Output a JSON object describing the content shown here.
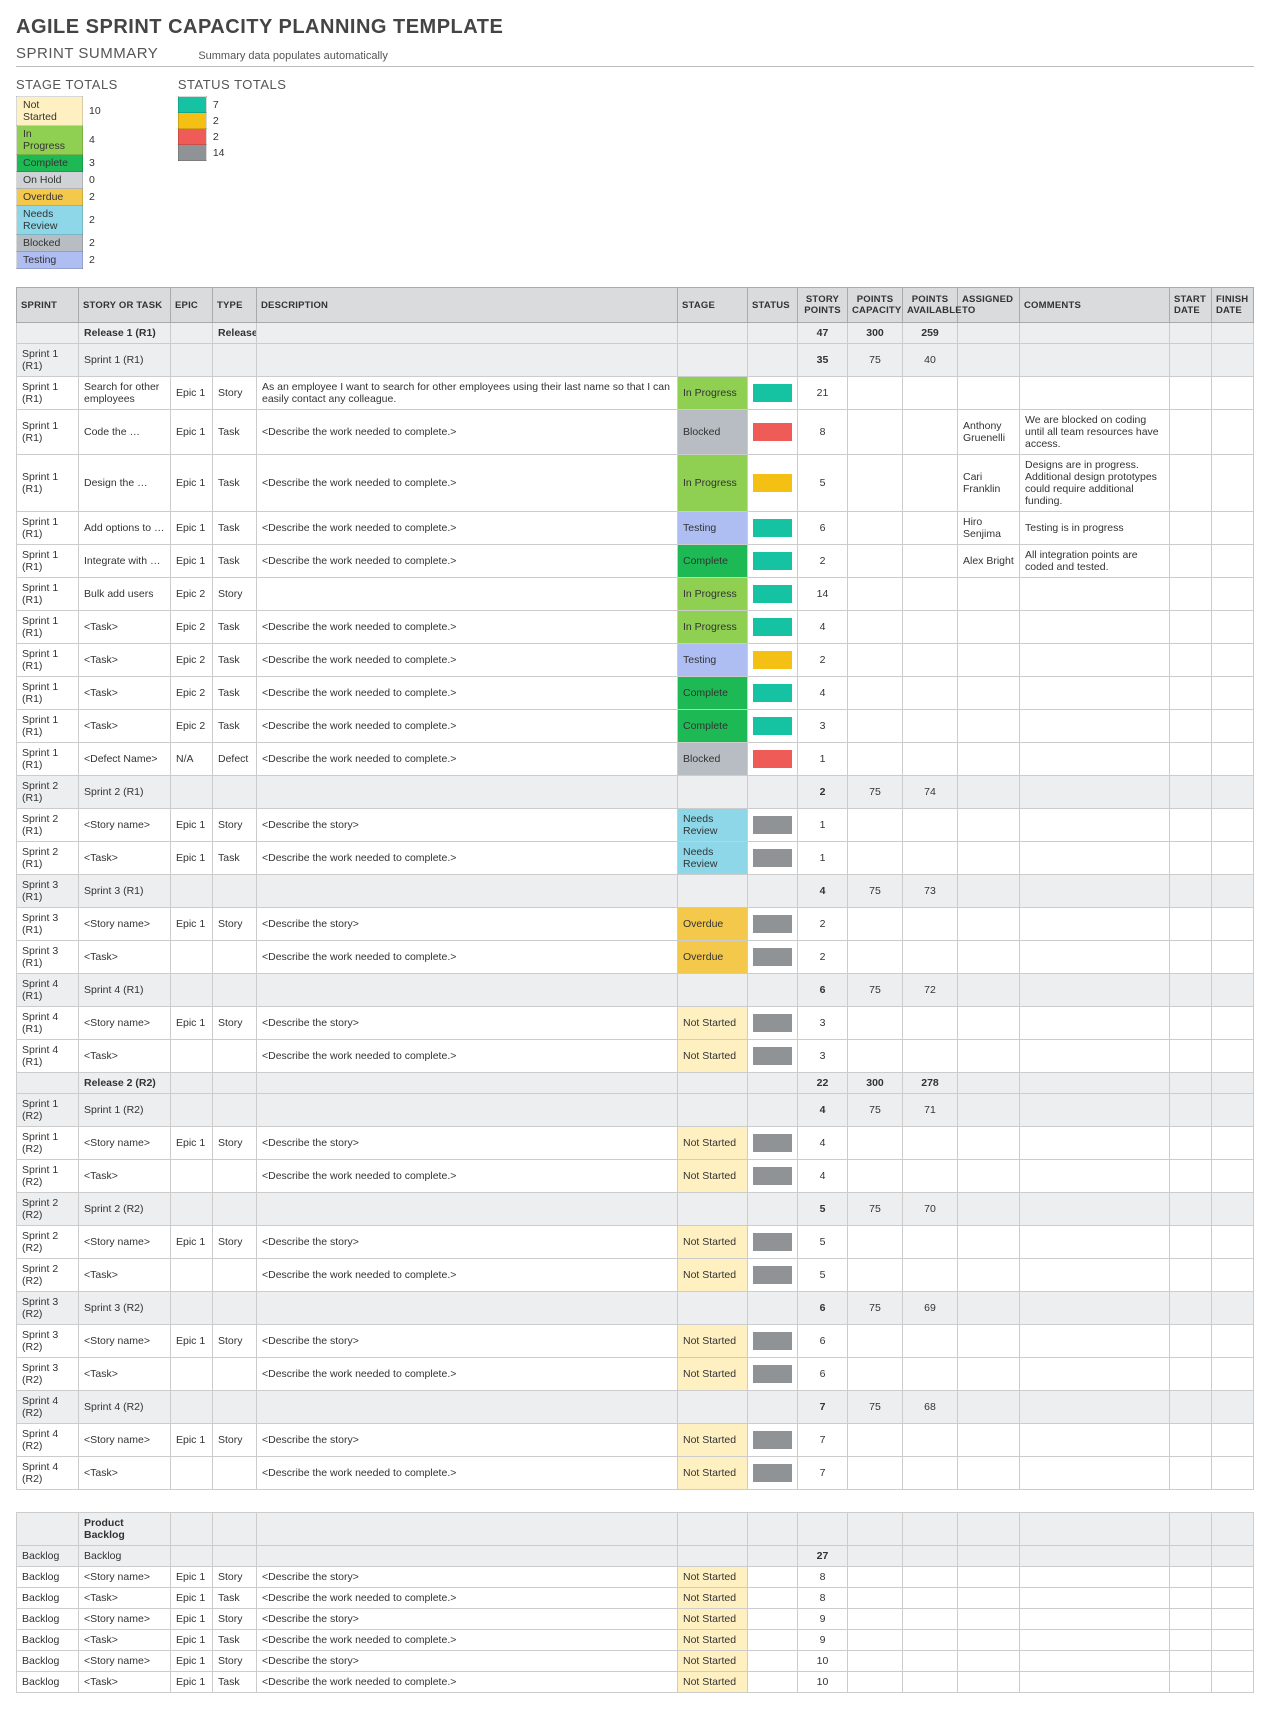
{
  "title": "AGILE SPRINT CAPACITY PLANNING TEMPLATE",
  "summary": {
    "heading": "SPRINT SUMMARY",
    "note": "Summary data populates automatically"
  },
  "stage_totals": {
    "heading": "STAGE TOTALS",
    "rows": [
      {
        "label": "Not Started",
        "count": 10,
        "color": "#fff0c2"
      },
      {
        "label": "In Progress",
        "count": 4,
        "color": "#8fd053"
      },
      {
        "label": "Complete",
        "count": 3,
        "color": "#1db954"
      },
      {
        "label": "On Hold",
        "count": 0,
        "color": "#cfd3d6"
      },
      {
        "label": "Overdue",
        "count": 2,
        "color": "#f4c84a"
      },
      {
        "label": "Needs Review",
        "count": 2,
        "color": "#8ed7e8"
      },
      {
        "label": "Blocked",
        "count": 2,
        "color": "#b7bdc2"
      },
      {
        "label": "Testing",
        "count": 2,
        "color": "#aebdf2"
      }
    ]
  },
  "status_totals": {
    "heading": "STATUS TOTALS",
    "rows": [
      {
        "color": "#15c3a3",
        "count": 7
      },
      {
        "color": "#f5c014",
        "count": 2
      },
      {
        "color": "#ef5b57",
        "count": 2
      },
      {
        "color": "#8f9396",
        "count": 14
      }
    ]
  },
  "columns": [
    "SPRINT",
    "STORY OR TASK",
    "EPIC",
    "TYPE",
    "DESCRIPTION",
    "STAGE",
    "STATUS",
    "STORY POINTS",
    "POINTS CAPACITY",
    "POINTS AVAILABLE",
    "ASSIGNED TO",
    "COMMENTS",
    "START DATE",
    "FINISH DATE"
  ],
  "stage_colors": {
    "Not Started": "#fff0c2",
    "In Progress": "#8fd053",
    "Complete": "#1db954",
    "On Hold": "#cfd3d6",
    "Overdue": "#f4c84a",
    "Needs Review": "#8ed7e8",
    "Blocked": "#b7bdc2",
    "Testing": "#aebdf2"
  },
  "rows": [
    {
      "kind": "release",
      "story": "Release 1 (R1)",
      "type": "Release",
      "points": 47,
      "cap": 300,
      "avail": 259
    },
    {
      "kind": "sprint",
      "sprint": "Sprint 1 (R1)",
      "story": "Sprint 1 (R1)",
      "points": 35,
      "cap": 75,
      "avail": 40
    },
    {
      "sprint": "Sprint 1 (R1)",
      "story": "Search for other employees",
      "epic": "Epic 1",
      "type": "Story",
      "desc": "As an employee I want to search for other employees using their last name so that I can easily contact any colleague.",
      "stage": "In Progress",
      "status": "#15c3a3",
      "points": 21
    },
    {
      "sprint": "Sprint 1 (R1)",
      "story": "Code the …",
      "epic": "Epic 1",
      "type": "Task",
      "desc": "<Describe the work needed to complete.>",
      "stage": "Blocked",
      "status": "#ef5b57",
      "points": 8,
      "assigned": "Anthony Gruenelli",
      "comments": "We are blocked on coding until all team resources have access."
    },
    {
      "sprint": "Sprint 1 (R1)",
      "story": "Design the …",
      "epic": "Epic 1",
      "type": "Task",
      "desc": "<Describe the work needed to complete.>",
      "stage": "In Progress",
      "status": "#f5c014",
      "points": 5,
      "assigned": "Cari Franklin",
      "comments": "Designs are in progress. Additional design prototypes could require additional funding."
    },
    {
      "sprint": "Sprint 1 (R1)",
      "story": "Add options to …",
      "epic": "Epic 1",
      "type": "Task",
      "desc": "<Describe the work needed to complete.>",
      "stage": "Testing",
      "status": "#15c3a3",
      "points": 6,
      "assigned": "Hiro Senjima",
      "comments": "Testing is in progress"
    },
    {
      "sprint": "Sprint 1 (R1)",
      "story": "Integrate with …",
      "epic": "Epic 1",
      "type": "Task",
      "desc": "<Describe the work needed to complete.>",
      "stage": "Complete",
      "status": "#15c3a3",
      "points": 2,
      "assigned": "Alex Bright",
      "comments": "All integration points are coded and tested."
    },
    {
      "sprint": "Sprint 1 (R1)",
      "story": "Bulk add users",
      "epic": "Epic 2",
      "type": "Story",
      "stage": "In Progress",
      "status": "#15c3a3",
      "points": 14
    },
    {
      "sprint": "Sprint 1 (R1)",
      "story": "<Task>",
      "epic": "Epic 2",
      "type": "Task",
      "desc": "<Describe the work needed to complete.>",
      "stage": "In Progress",
      "status": "#15c3a3",
      "points": 4
    },
    {
      "sprint": "Sprint 1 (R1)",
      "story": "<Task>",
      "epic": "Epic 2",
      "type": "Task",
      "desc": "<Describe the work needed to complete.>",
      "stage": "Testing",
      "status": "#f5c014",
      "points": 2
    },
    {
      "sprint": "Sprint 1 (R1)",
      "story": "<Task>",
      "epic": "Epic 2",
      "type": "Task",
      "desc": "<Describe the work needed to complete.>",
      "stage": "Complete",
      "status": "#15c3a3",
      "points": 4
    },
    {
      "sprint": "Sprint 1 (R1)",
      "story": "<Task>",
      "epic": "Epic 2",
      "type": "Task",
      "desc": "<Describe the work needed to complete.>",
      "stage": "Complete",
      "status": "#15c3a3",
      "points": 3
    },
    {
      "sprint": "Sprint 1 (R1)",
      "story": "<Defect Name>",
      "epic": "N/A",
      "type": "Defect",
      "desc": "<Describe the work needed to complete.>",
      "stage": "Blocked",
      "status": "#ef5b57",
      "points": 1
    },
    {
      "kind": "sprint",
      "sprint": "Sprint 2 (R1)",
      "story": "Sprint 2 (R1)",
      "points": 2,
      "cap": 75,
      "avail": 74
    },
    {
      "sprint": "Sprint 2 (R1)",
      "story": "<Story name>",
      "epic": "Epic 1",
      "type": "Story",
      "desc": "<Describe the story>",
      "stage": "Needs Review",
      "status": "#8f9396",
      "points": 1
    },
    {
      "sprint": "Sprint 2 (R1)",
      "story": "<Task>",
      "epic": "Epic 1",
      "type": "Task",
      "desc": "<Describe the work needed to complete.>",
      "stage": "Needs Review",
      "status": "#8f9396",
      "points": 1
    },
    {
      "kind": "sprint",
      "sprint": "Sprint 3 (R1)",
      "story": "Sprint 3 (R1)",
      "points": 4,
      "cap": 75,
      "avail": 73
    },
    {
      "sprint": "Sprint 3 (R1)",
      "story": "<Story name>",
      "epic": "Epic 1",
      "type": "Story",
      "desc": "<Describe the story>",
      "stage": "Overdue",
      "status": "#8f9396",
      "points": 2
    },
    {
      "sprint": "Sprint 3 (R1)",
      "story": "<Task>",
      "type": "",
      "desc": "<Describe the work needed to complete.>",
      "stage": "Overdue",
      "status": "#8f9396",
      "points": 2
    },
    {
      "kind": "sprint",
      "sprint": "Sprint 4 (R1)",
      "story": "Sprint 4 (R1)",
      "points": 6,
      "cap": 75,
      "avail": 72
    },
    {
      "sprint": "Sprint 4 (R1)",
      "story": "<Story name>",
      "epic": "Epic 1",
      "type": "Story",
      "desc": "<Describe the story>",
      "stage": "Not Started",
      "status": "#8f9396",
      "points": 3
    },
    {
      "sprint": "Sprint 4 (R1)",
      "story": "<Task>",
      "type": "",
      "desc": "<Describe the work needed to complete.>",
      "stage": "Not Started",
      "status": "#8f9396",
      "points": 3
    },
    {
      "kind": "release",
      "story": "Release 2 (R2)",
      "points": 22,
      "cap": 300,
      "avail": 278
    },
    {
      "kind": "sprint",
      "sprint": "Sprint 1 (R2)",
      "story": "Sprint 1 (R2)",
      "points": 4,
      "cap": 75,
      "avail": 71
    },
    {
      "sprint": "Sprint 1 (R2)",
      "story": "<Story name>",
      "epic": "Epic 1",
      "type": "Story",
      "desc": "<Describe the story>",
      "stage": "Not Started",
      "status": "#8f9396",
      "points": 4
    },
    {
      "sprint": "Sprint 1 (R2)",
      "story": "<Task>",
      "type": "",
      "desc": "<Describe the work needed to complete.>",
      "stage": "Not Started",
      "status": "#8f9396",
      "points": 4
    },
    {
      "kind": "sprint",
      "sprint": "Sprint 2 (R2)",
      "story": "Sprint 2 (R2)",
      "points": 5,
      "cap": 75,
      "avail": 70
    },
    {
      "sprint": "Sprint 2 (R2)",
      "story": "<Story name>",
      "epic": "Epic 1",
      "type": "Story",
      "desc": "<Describe the story>",
      "stage": "Not Started",
      "status": "#8f9396",
      "points": 5
    },
    {
      "sprint": "Sprint 2 (R2)",
      "story": "<Task>",
      "type": "",
      "desc": "<Describe the work needed to complete.>",
      "stage": "Not Started",
      "status": "#8f9396",
      "points": 5
    },
    {
      "kind": "sprint",
      "sprint": "Sprint 3 (R2)",
      "story": "Sprint 3 (R2)",
      "points": 6,
      "cap": 75,
      "avail": 69
    },
    {
      "sprint": "Sprint 3 (R2)",
      "story": "<Story name>",
      "epic": "Epic 1",
      "type": "Story",
      "desc": "<Describe the story>",
      "stage": "Not Started",
      "status": "#8f9396",
      "points": 6
    },
    {
      "sprint": "Sprint 3 (R2)",
      "story": "<Task>",
      "type": "",
      "desc": "<Describe the work needed to complete.>",
      "stage": "Not Started",
      "status": "#8f9396",
      "points": 6
    },
    {
      "kind": "sprint",
      "sprint": "Sprint 4 (R2)",
      "story": "Sprint 4 (R2)",
      "points": 7,
      "cap": 75,
      "avail": 68
    },
    {
      "sprint": "Sprint 4 (R2)",
      "story": "<Story name>",
      "epic": "Epic 1",
      "type": "Story",
      "desc": "<Describe the story>",
      "stage": "Not Started",
      "status": "#8f9396",
      "points": 7
    },
    {
      "sprint": "Sprint 4 (R2)",
      "story": "<Task>",
      "type": "",
      "desc": "<Describe the work needed to complete.>",
      "stage": "Not Started",
      "status": "#8f9396",
      "points": 7
    }
  ],
  "backlog": {
    "header": "Product Backlog",
    "rows": [
      {
        "kind": "sprint",
        "sprint": "Backlog",
        "story": "Backlog",
        "points": 27
      },
      {
        "sprint": "Backlog",
        "story": "<Story name>",
        "epic": "Epic 1",
        "type": "Story",
        "desc": "<Describe the story>",
        "stage": "Not Started",
        "points": 8
      },
      {
        "sprint": "Backlog",
        "story": "<Task>",
        "epic": "Epic 1",
        "type": "Task",
        "desc": "<Describe the work needed to complete.>",
        "stage": "Not Started",
        "points": 8
      },
      {
        "sprint": "Backlog",
        "story": "<Story name>",
        "epic": "Epic 1",
        "type": "Story",
        "desc": "<Describe the story>",
        "stage": "Not Started",
        "points": 9
      },
      {
        "sprint": "Backlog",
        "story": "<Task>",
        "epic": "Epic 1",
        "type": "Task",
        "desc": "<Describe the work needed to complete.>",
        "stage": "Not Started",
        "points": 9
      },
      {
        "sprint": "Backlog",
        "story": "<Story name>",
        "epic": "Epic 1",
        "type": "Story",
        "desc": "<Describe the story>",
        "stage": "Not Started",
        "points": 10
      },
      {
        "sprint": "Backlog",
        "story": "<Task>",
        "epic": "Epic 1",
        "type": "Task",
        "desc": "<Describe the work needed to complete.>",
        "stage": "Not Started",
        "points": 10
      }
    ]
  }
}
